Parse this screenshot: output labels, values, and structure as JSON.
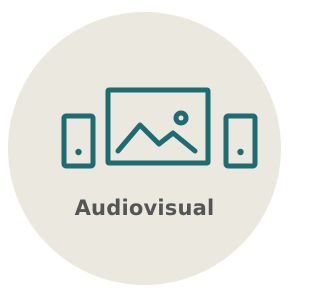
{
  "tile": {
    "label": "Audiovisual",
    "icon": "audiovisual-icon",
    "background_color": "#eae8df",
    "icon_color": "#1e6b72",
    "label_color": "#555555"
  }
}
